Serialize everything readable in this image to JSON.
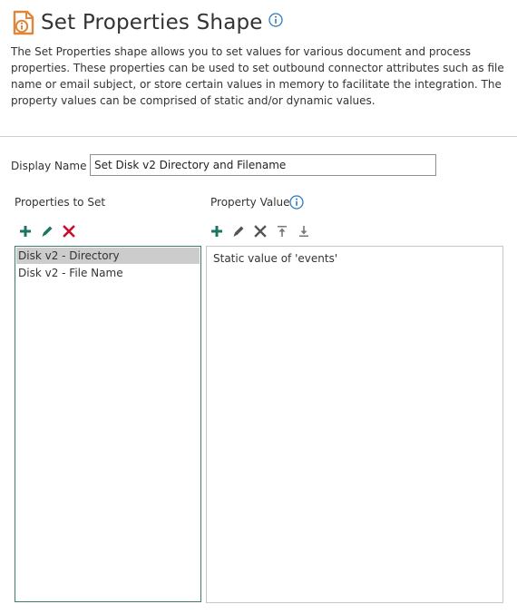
{
  "header": {
    "title": "Set Properties Shape",
    "description": "The Set Properties shape allows you to set values for various document and process properties. These properties can be used to set outbound connector attributes such as file name or email subject, or store certain values in memory to facilitate the integration. The property values can be comprised of static and/or dynamic values."
  },
  "display_name": {
    "label": "Display Name",
    "value": "Set Disk v2 Directory and Filename"
  },
  "properties_panel": {
    "label": "Properties to Set",
    "items": [
      "Disk v2 - Directory",
      "Disk v2 - File Name"
    ],
    "selected_index": 0
  },
  "value_panel": {
    "label": "Property Value",
    "items": [
      "Static value of 'events'"
    ]
  },
  "icons": {
    "shape": "set-properties-shape-icon",
    "info": "info-icon",
    "add": "plus-icon",
    "edit": "pencil-icon",
    "delete": "x-icon",
    "move_top": "move-to-top-icon",
    "move_bottom": "move-to-bottom-icon"
  },
  "colors": {
    "accent_green": "#1e7563",
    "delete_red": "#c8102e",
    "shape_orange": "#e0863a",
    "info_blue": "#2a7bbf",
    "selected_row": "#cccccc"
  }
}
